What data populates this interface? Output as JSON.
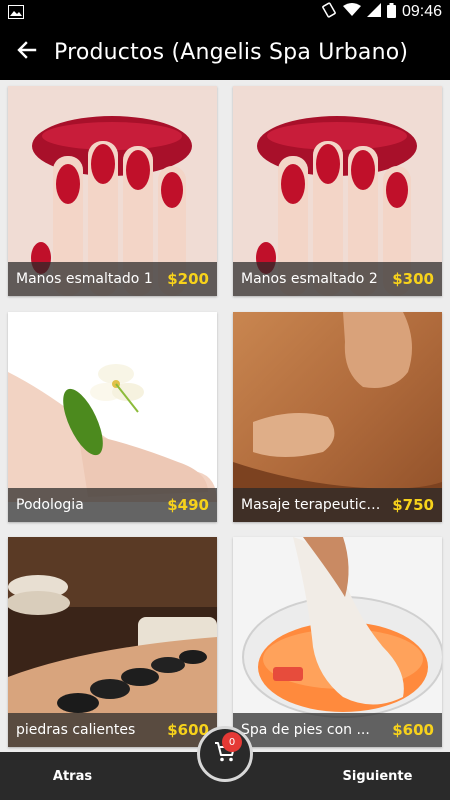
{
  "status_bar": {
    "time": "09:46",
    "icons": [
      "image-icon",
      "vibrate-icon",
      "wifi-icon",
      "signal-icon",
      "battery-icon"
    ]
  },
  "app_bar": {
    "title": "Productos (Angelis Spa Urbano)",
    "back_icon": "arrow-back-icon"
  },
  "products": [
    {
      "name": "Manos esmaltado 1",
      "price": "$200",
      "image": "red-lips-nails-photo"
    },
    {
      "name": "Manos esmaltado 2",
      "price": "$300",
      "image": "red-lips-nails-photo"
    },
    {
      "name": "Podologia",
      "price": "$490",
      "image": "foot-lily-photo"
    },
    {
      "name": "Masaje terapeutico, ...",
      "price": "$750",
      "image": "back-massage-photo"
    },
    {
      "name": "piedras calientes",
      "price": "$600",
      "image": "hot-stones-photo"
    },
    {
      "name": "Spa de pies con ...",
      "price": "$600",
      "image": "foot-spa-photo"
    }
  ],
  "bottom_bar": {
    "back_label": "Atras",
    "next_label": "Siguiente"
  },
  "cart": {
    "count": "0",
    "icon": "shopping-cart-icon"
  },
  "colors": {
    "app_bar": "#000000",
    "bottom_bar": "#2a2a2a",
    "price": "#f7d21b",
    "badge": "#e53935"
  }
}
